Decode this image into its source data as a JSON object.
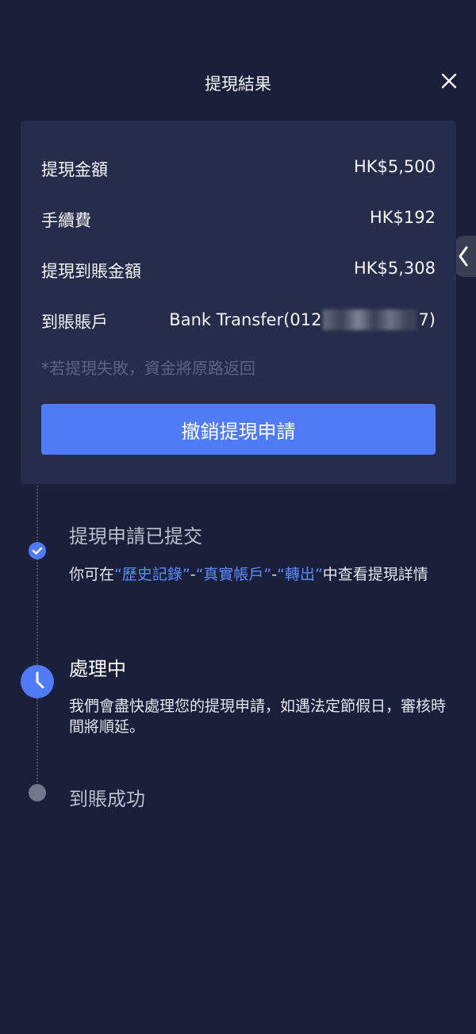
{
  "header": {
    "title": "提現結果"
  },
  "summary": {
    "amount_label": "提現金額",
    "amount_value": "HK$5,500",
    "fee_label": "手續費",
    "fee_value": "HK$192",
    "received_label": "提現到賬金額",
    "received_value": "HK$5,308",
    "account_label": "到賬賬戶",
    "account_prefix": "Bank Transfer(012",
    "account_suffix": "7)",
    "note": "*若提現失敗，資金將原路返回",
    "cancel_button": "撤銷提現申請"
  },
  "timeline": {
    "step1": {
      "title": "提現申請已提交",
      "desc_prefix": "你可在",
      "link1": "“歷史記錄”",
      "sep1": "-",
      "link2": "“真實帳戶”",
      "sep2": "-",
      "link3": "“轉出”",
      "desc_suffix": "中查看提現詳情"
    },
    "step2": {
      "title": "處理中",
      "desc": "我們會盡快處理您的提現申請，如遇法定節假日，審核時間將順延。"
    },
    "step3": {
      "title": "到賬成功"
    }
  },
  "icons": {
    "close": "close-icon",
    "side_handle": "chevron-left-icon",
    "step1": "check-icon",
    "step2": "clock-icon"
  },
  "colors": {
    "background": "#1a1f3a",
    "card": "#262d4a",
    "accent": "#4f7bf7",
    "link": "#5b8cff",
    "muted": "#5d6480"
  }
}
